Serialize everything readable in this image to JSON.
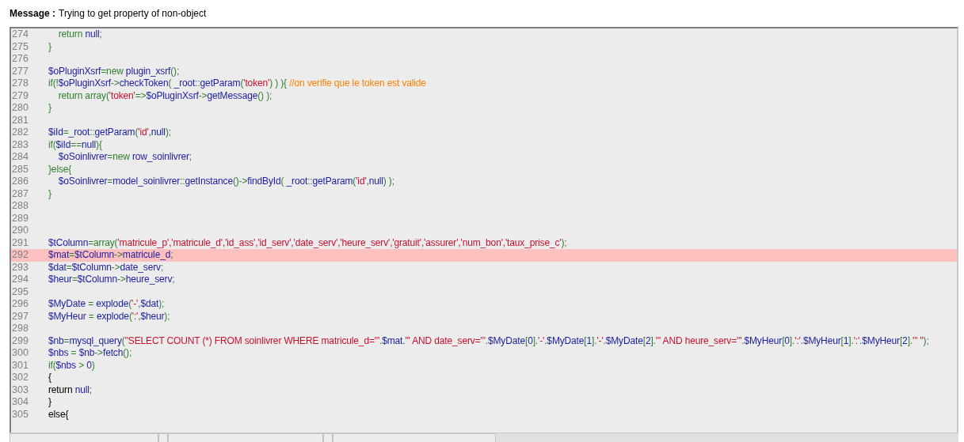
{
  "message": {
    "label": "Message :",
    "text": "Trying to get property of non-object"
  },
  "code_lines": [
    {
      "number": "274",
      "highlighted": false,
      "segments": [
        {
          "kind": "keyword",
          "text": "    return "
        },
        {
          "kind": "default",
          "text": "null"
        },
        {
          "kind": "keyword",
          "text": ";"
        }
      ]
    },
    {
      "number": "275",
      "highlighted": false,
      "segments": [
        {
          "kind": "keyword",
          "text": "}"
        }
      ]
    },
    {
      "number": "276",
      "highlighted": false
    },
    {
      "number": "277",
      "highlighted": false,
      "segments": [
        {
          "kind": "default",
          "text": "$oPluginXsrf"
        },
        {
          "kind": "keyword",
          "text": "=new "
        },
        {
          "kind": "default",
          "text": "plugin_xsrf"
        },
        {
          "kind": "keyword",
          "text": "();"
        }
      ]
    },
    {
      "number": "278",
      "highlighted": false,
      "segments": [
        {
          "kind": "keyword",
          "text": "if(!"
        },
        {
          "kind": "default",
          "text": "$oPluginXsrf"
        },
        {
          "kind": "keyword",
          "text": "->"
        },
        {
          "kind": "default",
          "text": "checkToken"
        },
        {
          "kind": "keyword",
          "text": "( "
        },
        {
          "kind": "default",
          "text": "_root"
        },
        {
          "kind": "keyword",
          "text": "::"
        },
        {
          "kind": "default",
          "text": "getParam"
        },
        {
          "kind": "keyword",
          "text": "("
        },
        {
          "kind": "string",
          "text": "'token'"
        },
        {
          "kind": "keyword",
          "text": ") ) ){ "
        },
        {
          "kind": "comment",
          "text": "//on verifie que le token est valide"
        }
      ]
    },
    {
      "number": "279",
      "highlighted": false,
      "segments": [
        {
          "kind": "keyword",
          "text": "    return array("
        },
        {
          "kind": "string",
          "text": "'token'"
        },
        {
          "kind": "keyword",
          "text": "=>"
        },
        {
          "kind": "default",
          "text": "$oPluginXsrf"
        },
        {
          "kind": "keyword",
          "text": "->"
        },
        {
          "kind": "default",
          "text": "getMessage"
        },
        {
          "kind": "keyword",
          "text": "() );"
        }
      ]
    },
    {
      "number": "280",
      "highlighted": false,
      "segments": [
        {
          "kind": "keyword",
          "text": "}"
        }
      ]
    },
    {
      "number": "281",
      "highlighted": false
    },
    {
      "number": "282",
      "highlighted": false,
      "segments": [
        {
          "kind": "default",
          "text": "$iId"
        },
        {
          "kind": "keyword",
          "text": "="
        },
        {
          "kind": "default",
          "text": "_root"
        },
        {
          "kind": "keyword",
          "text": "::"
        },
        {
          "kind": "default",
          "text": "getParam"
        },
        {
          "kind": "keyword",
          "text": "("
        },
        {
          "kind": "string",
          "text": "'id'"
        },
        {
          "kind": "keyword",
          "text": ","
        },
        {
          "kind": "default",
          "text": "null"
        },
        {
          "kind": "keyword",
          "text": ");"
        }
      ]
    },
    {
      "number": "283",
      "highlighted": false,
      "segments": [
        {
          "kind": "keyword",
          "text": "if("
        },
        {
          "kind": "default",
          "text": "$iId"
        },
        {
          "kind": "keyword",
          "text": "=="
        },
        {
          "kind": "default",
          "text": "null"
        },
        {
          "kind": "keyword",
          "text": "){"
        }
      ]
    },
    {
      "number": "284",
      "highlighted": false,
      "segments": [
        {
          "kind": "default",
          "text": "    $oSoinlivrer"
        },
        {
          "kind": "keyword",
          "text": "=new "
        },
        {
          "kind": "default",
          "text": "row_soinlivrer"
        },
        {
          "kind": "keyword",
          "text": ";"
        }
      ]
    },
    {
      "number": "285",
      "highlighted": false,
      "segments": [
        {
          "kind": "keyword",
          "text": "}else{"
        }
      ]
    },
    {
      "number": "286",
      "highlighted": false,
      "segments": [
        {
          "kind": "default",
          "text": "    $oSoinlivrer"
        },
        {
          "kind": "keyword",
          "text": "="
        },
        {
          "kind": "default",
          "text": "model_soinlivrer"
        },
        {
          "kind": "keyword",
          "text": "::"
        },
        {
          "kind": "default",
          "text": "getInstance"
        },
        {
          "kind": "keyword",
          "text": "()->"
        },
        {
          "kind": "default",
          "text": "findById"
        },
        {
          "kind": "keyword",
          "text": "( "
        },
        {
          "kind": "default",
          "text": "_root"
        },
        {
          "kind": "keyword",
          "text": "::"
        },
        {
          "kind": "default",
          "text": "getParam"
        },
        {
          "kind": "keyword",
          "text": "("
        },
        {
          "kind": "string",
          "text": "'id'"
        },
        {
          "kind": "keyword",
          "text": ","
        },
        {
          "kind": "default",
          "text": "null"
        },
        {
          "kind": "keyword",
          "text": ") );"
        }
      ]
    },
    {
      "number": "287",
      "highlighted": false,
      "segments": [
        {
          "kind": "keyword",
          "text": "}"
        }
      ]
    },
    {
      "number": "288",
      "highlighted": false
    },
    {
      "number": "289",
      "highlighted": false
    },
    {
      "number": "290",
      "highlighted": false
    },
    {
      "number": "291",
      "highlighted": false,
      "segments": [
        {
          "kind": "default",
          "text": "$tColumn"
        },
        {
          "kind": "keyword",
          "text": "=array("
        },
        {
          "kind": "string",
          "text": "'matricule_p','matricule_d','id_ass','id_serv','date_serv','heure_serv','gratuit','assurer','num_bon','taux_prise_c'"
        },
        {
          "kind": "keyword",
          "text": ");"
        }
      ]
    },
    {
      "number": "292",
      "highlighted": true,
      "segments": [
        {
          "kind": "default",
          "text": "$mat"
        },
        {
          "kind": "keyword",
          "text": "="
        },
        {
          "kind": "default",
          "text": "$tColumn"
        },
        {
          "kind": "keyword",
          "text": "->"
        },
        {
          "kind": "default",
          "text": "matricule_d"
        },
        {
          "kind": "keyword",
          "text": ";"
        }
      ]
    },
    {
      "number": "293",
      "highlighted": false,
      "segments": [
        {
          "kind": "default",
          "text": "$dat"
        },
        {
          "kind": "keyword",
          "text": "="
        },
        {
          "kind": "default",
          "text": "$tColumn"
        },
        {
          "kind": "keyword",
          "text": "->"
        },
        {
          "kind": "default",
          "text": "date_serv"
        },
        {
          "kind": "keyword",
          "text": ";"
        }
      ]
    },
    {
      "number": "294",
      "highlighted": false,
      "segments": [
        {
          "kind": "default",
          "text": "$heur"
        },
        {
          "kind": "keyword",
          "text": "="
        },
        {
          "kind": "default",
          "text": "$tColumn"
        },
        {
          "kind": "keyword",
          "text": "->"
        },
        {
          "kind": "default",
          "text": "heure_serv"
        },
        {
          "kind": "keyword",
          "text": ";"
        }
      ]
    },
    {
      "number": "295",
      "highlighted": false
    },
    {
      "number": "296",
      "highlighted": false,
      "segments": [
        {
          "kind": "default",
          "text": "$MyDate "
        },
        {
          "kind": "keyword",
          "text": "= "
        },
        {
          "kind": "default",
          "text": "explode"
        },
        {
          "kind": "keyword",
          "text": "("
        },
        {
          "kind": "string",
          "text": "'-'"
        },
        {
          "kind": "keyword",
          "text": ","
        },
        {
          "kind": "default",
          "text": "$dat"
        },
        {
          "kind": "keyword",
          "text": ");"
        }
      ]
    },
    {
      "number": "297",
      "highlighted": false,
      "segments": [
        {
          "kind": "default",
          "text": "$MyHeur "
        },
        {
          "kind": "keyword",
          "text": "= "
        },
        {
          "kind": "default",
          "text": "explode"
        },
        {
          "kind": "keyword",
          "text": "("
        },
        {
          "kind": "string",
          "text": "':'"
        },
        {
          "kind": "keyword",
          "text": ","
        },
        {
          "kind": "default",
          "text": "$heur"
        },
        {
          "kind": "keyword",
          "text": ");"
        }
      ]
    },
    {
      "number": "298",
      "highlighted": false
    },
    {
      "number": "299",
      "highlighted": false,
      "segments": [
        {
          "kind": "default",
          "text": "$nb"
        },
        {
          "kind": "keyword",
          "text": "="
        },
        {
          "kind": "default",
          "text": "mysql_query"
        },
        {
          "kind": "keyword",
          "text": "("
        },
        {
          "kind": "string",
          "text": "\"SELECT COUNT (*) FROM soinlivrer WHERE matricule_d='\""
        },
        {
          "kind": "keyword",
          "text": "."
        },
        {
          "kind": "default",
          "text": "$mat"
        },
        {
          "kind": "keyword",
          "text": "."
        },
        {
          "kind": "string",
          "text": "\"' AND date_serv='\""
        },
        {
          "kind": "keyword",
          "text": "."
        },
        {
          "kind": "default",
          "text": "$MyDate"
        },
        {
          "kind": "keyword",
          "text": "["
        },
        {
          "kind": "default",
          "text": "0"
        },
        {
          "kind": "keyword",
          "text": "]."
        },
        {
          "kind": "string",
          "text": "'-'"
        },
        {
          "kind": "keyword",
          "text": "."
        },
        {
          "kind": "default",
          "text": "$MyDate"
        },
        {
          "kind": "keyword",
          "text": "["
        },
        {
          "kind": "default",
          "text": "1"
        },
        {
          "kind": "keyword",
          "text": "]."
        },
        {
          "kind": "string",
          "text": "'-'"
        },
        {
          "kind": "keyword",
          "text": "."
        },
        {
          "kind": "default",
          "text": "$MyDate"
        },
        {
          "kind": "keyword",
          "text": "["
        },
        {
          "kind": "default",
          "text": "2"
        },
        {
          "kind": "keyword",
          "text": "]."
        },
        {
          "kind": "string",
          "text": "\"' AND heure_serv='\""
        },
        {
          "kind": "keyword",
          "text": "."
        },
        {
          "kind": "default",
          "text": "$MyHeur"
        },
        {
          "kind": "keyword",
          "text": "["
        },
        {
          "kind": "default",
          "text": "0"
        },
        {
          "kind": "keyword",
          "text": "]."
        },
        {
          "kind": "string",
          "text": "':'"
        },
        {
          "kind": "keyword",
          "text": "."
        },
        {
          "kind": "default",
          "text": "$MyHeur"
        },
        {
          "kind": "keyword",
          "text": "["
        },
        {
          "kind": "default",
          "text": "1"
        },
        {
          "kind": "keyword",
          "text": "]."
        },
        {
          "kind": "string",
          "text": "':'"
        },
        {
          "kind": "keyword",
          "text": "."
        },
        {
          "kind": "default",
          "text": "$MyHeur"
        },
        {
          "kind": "keyword",
          "text": "["
        },
        {
          "kind": "default",
          "text": "2"
        },
        {
          "kind": "keyword",
          "text": "]."
        },
        {
          "kind": "string",
          "text": "\"' \""
        },
        {
          "kind": "keyword",
          "text": ");"
        }
      ]
    },
    {
      "number": "300",
      "highlighted": false,
      "segments": [
        {
          "kind": "default",
          "text": "$nbs "
        },
        {
          "kind": "keyword",
          "text": "= "
        },
        {
          "kind": "default",
          "text": "$nb"
        },
        {
          "kind": "keyword",
          "text": "->"
        },
        {
          "kind": "default",
          "text": "fetch"
        },
        {
          "kind": "keyword",
          "text": "();"
        }
      ]
    },
    {
      "number": "301",
      "highlighted": false,
      "segments": [
        {
          "kind": "keyword",
          "text": "if("
        },
        {
          "kind": "default",
          "text": "$nbs "
        },
        {
          "kind": "keyword",
          "text": "> "
        },
        {
          "kind": "default",
          "text": "0"
        },
        {
          "kind": "keyword",
          "text": ")"
        }
      ]
    },
    {
      "number": "302",
      "highlighted": false,
      "segments": [
        {
          "kind": "html",
          "text": "{"
        }
      ]
    },
    {
      "number": "303",
      "highlighted": false,
      "segments": [
        {
          "kind": "html",
          "text": "return "
        },
        {
          "kind": "default",
          "text": "null"
        },
        {
          "kind": "keyword",
          "text": ";"
        }
      ]
    },
    {
      "number": "304",
      "highlighted": false,
      "segments": [
        {
          "kind": "html",
          "text": "}"
        }
      ]
    },
    {
      "number": "305",
      "highlighted": false,
      "segments": [
        {
          "kind": "html",
          "text": "else{"
        }
      ]
    }
  ]
}
